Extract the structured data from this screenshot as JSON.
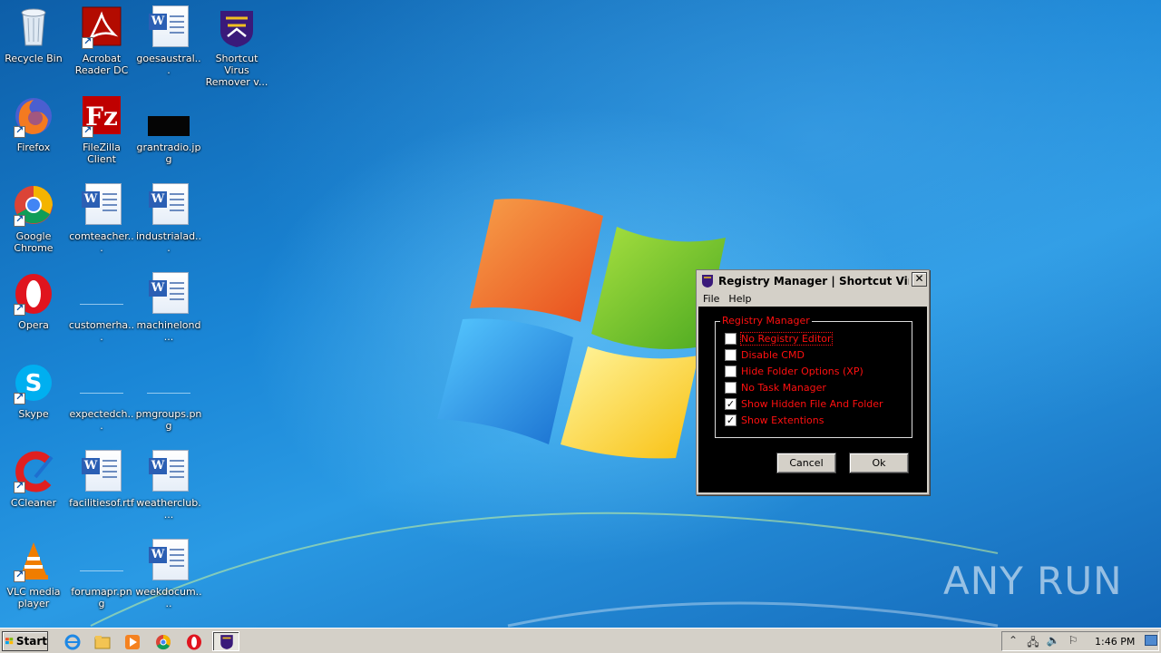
{
  "desktop_icons": [
    {
      "label": "Recycle Bin",
      "icon": "recycle-bin-icon"
    },
    {
      "label": "Acrobat Reader DC",
      "icon": "acrobat-reader-icon"
    },
    {
      "label": "goesaustral...",
      "icon": "word-document-icon"
    },
    {
      "label": "Shortcut Virus Remover v...",
      "icon": "shortcut-virus-remover-icon"
    },
    {
      "label": "Firefox",
      "icon": "firefox-icon"
    },
    {
      "label": "FileZilla Client",
      "icon": "filezilla-icon"
    },
    {
      "label": "grantradio.jpg",
      "icon": "image-file-icon"
    },
    {
      "label": "Google Chrome",
      "icon": "chrome-icon"
    },
    {
      "label": "comteacher...",
      "icon": "word-document-icon"
    },
    {
      "label": "industrialad...",
      "icon": "word-document-icon"
    },
    {
      "label": "Opera",
      "icon": "opera-icon"
    },
    {
      "label": "customerha...",
      "icon": "image-file-icon"
    },
    {
      "label": "machinelond...",
      "icon": "word-document-icon"
    },
    {
      "label": "Skype",
      "icon": "skype-icon"
    },
    {
      "label": "expectedch...",
      "icon": "image-file-icon"
    },
    {
      "label": "pmgroups.png",
      "icon": "image-file-icon"
    },
    {
      "label": "CCleaner",
      "icon": "ccleaner-icon"
    },
    {
      "label": "facilitiesof.rtf",
      "icon": "word-document-icon"
    },
    {
      "label": "weatherclub....",
      "icon": "word-document-icon"
    },
    {
      "label": "VLC media player",
      "icon": "vlc-icon"
    },
    {
      "label": "forumapr.png",
      "icon": "image-file-icon"
    },
    {
      "label": "weekdocum....",
      "icon": "word-document-icon"
    }
  ],
  "dialog": {
    "title": "Registry Manager | Shortcut Virus ...",
    "close_label": "✕",
    "menu": [
      "File",
      "Help"
    ],
    "group_label": "Registry Manager",
    "options": [
      {
        "label": "No Registry Editor",
        "checked": false
      },
      {
        "label": "Disable CMD",
        "checked": false
      },
      {
        "label": "Hide Folder Options (XP)",
        "checked": false
      },
      {
        "label": "No Task Manager",
        "checked": false
      },
      {
        "label": "Show Hidden File And Folder",
        "checked": true
      },
      {
        "label": "Show Extentions",
        "checked": true
      }
    ],
    "cancel_label": "Cancel",
    "ok_label": "Ok",
    "text_color": "#ff1010"
  },
  "taskbar": {
    "start_label": "Start",
    "quick_launch": [
      "internet-explorer-icon",
      "file-explorer-icon",
      "media-player-icon",
      "chrome-icon",
      "opera-icon"
    ],
    "task": "shortcut-virus-remover-icon",
    "tray_icons": [
      "show-hidden-icons-icon",
      "network-icon",
      "volume-icon",
      "action-center-flag-icon"
    ],
    "clock": "1:46 PM"
  },
  "watermark": "ANY RUN"
}
